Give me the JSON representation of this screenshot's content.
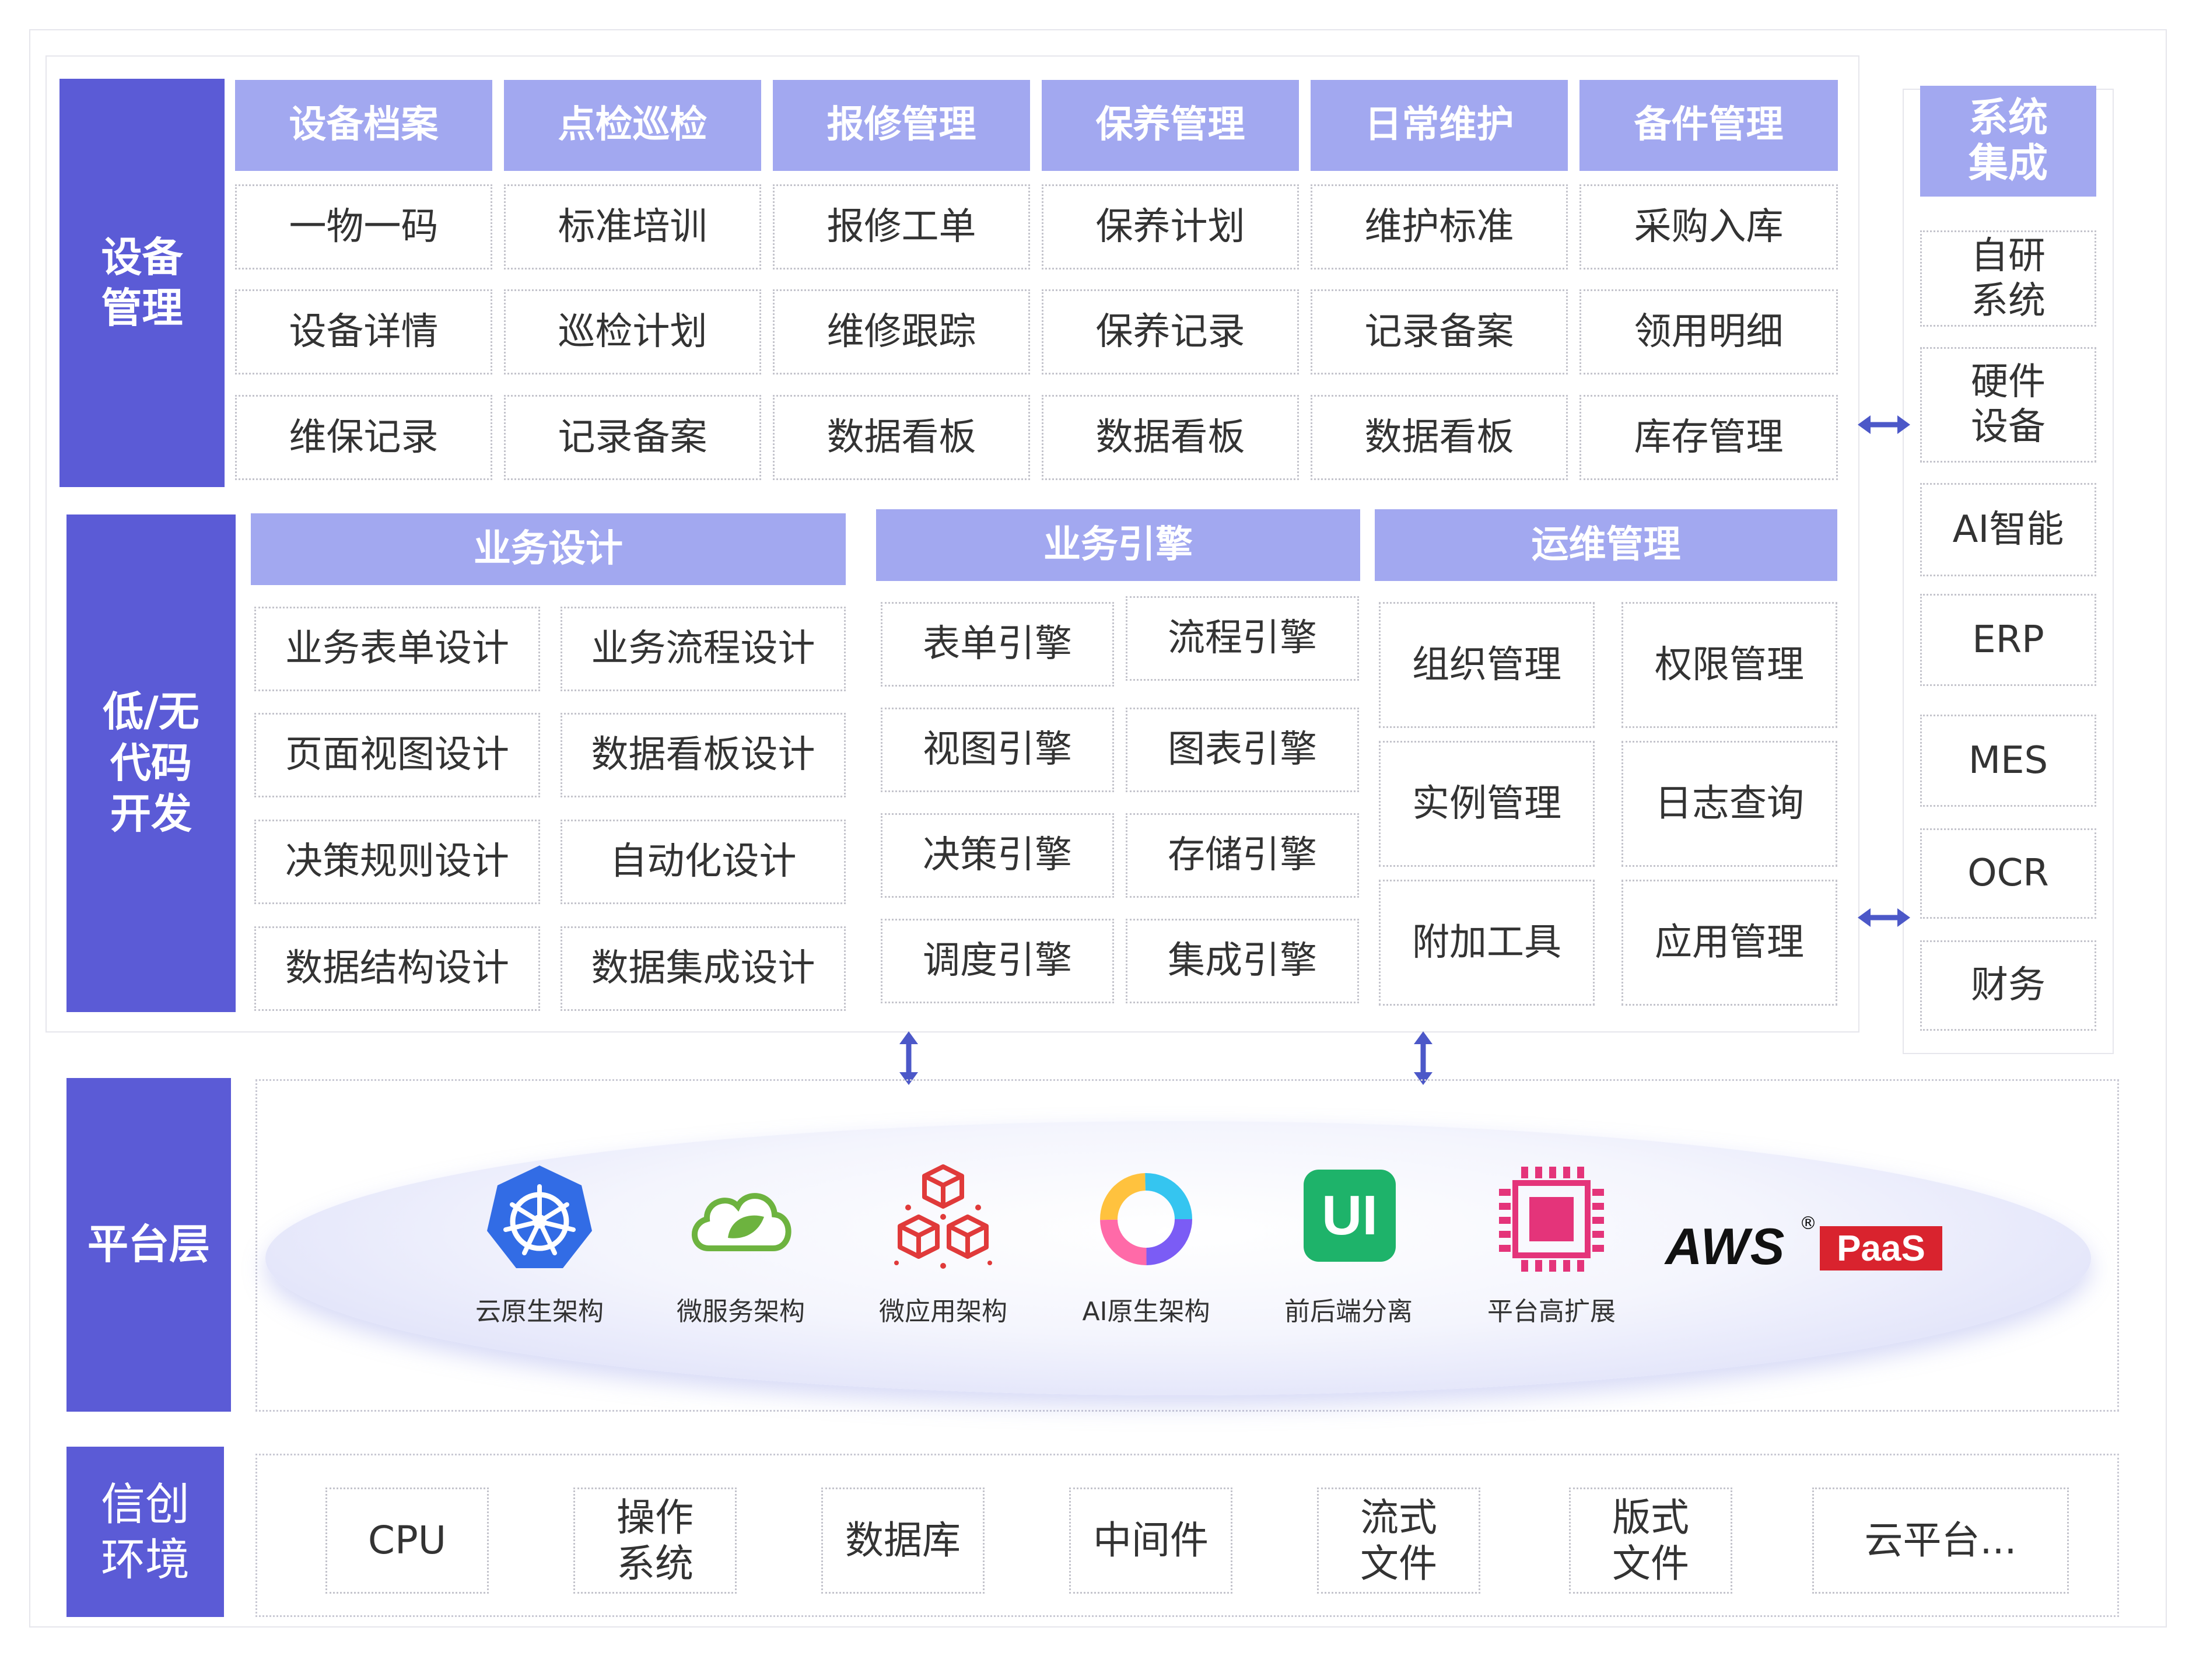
{
  "colors": {
    "side_bg": "#5b5bd6",
    "header_bg": "#a2a8f0",
    "arrow": "#4c58c8",
    "aws_red": "#d9232e"
  },
  "device_mgmt": {
    "label": "设备\n管理",
    "columns": [
      {
        "header": "设备档案",
        "items": [
          "一物一码",
          "设备详情",
          "维保记录"
        ]
      },
      {
        "header": "点检巡检",
        "items": [
          "标准培训",
          "巡检计划",
          "记录备案"
        ]
      },
      {
        "header": "报修管理",
        "items": [
          "报修工单",
          "维修跟踪",
          "数据看板"
        ]
      },
      {
        "header": "保养管理",
        "items": [
          "保养计划",
          "保养记录",
          "数据看板"
        ]
      },
      {
        "header": "日常维护",
        "items": [
          "维护标准",
          "记录备案",
          "数据看板"
        ]
      },
      {
        "header": "备件管理",
        "items": [
          "采购入库",
          "领用明细",
          "库存管理"
        ]
      }
    ]
  },
  "lowcode": {
    "label": "低/无\n代码\n开发",
    "groups": [
      {
        "header": "业务设计",
        "items": [
          "业务表单设计",
          "业务流程设计",
          "页面视图设计",
          "数据看板设计",
          "决策规则设计",
          "自动化设计",
          "数据结构设计",
          "数据集成设计"
        ]
      },
      {
        "header": "业务引擎",
        "items": [
          "表单引擎",
          "流程引擎",
          "视图引擎",
          "图表引擎",
          "决策引擎",
          "存储引擎",
          "调度引擎",
          "集成引擎"
        ]
      },
      {
        "header": "运维管理",
        "items": [
          "组织管理",
          "权限管理",
          "实例管理",
          "日志查询",
          "附加工具",
          "应用管理"
        ]
      }
    ]
  },
  "system_integration": {
    "header": "系统\n集成",
    "items": [
      "自研\n系统",
      "硬件\n设备",
      "AI智能",
      "ERP",
      "MES",
      "OCR",
      "财务"
    ]
  },
  "platform": {
    "label": "平台层",
    "items": [
      {
        "icon": "kubernetes-icon",
        "label": "云原生架构"
      },
      {
        "icon": "spring-cloud-icon",
        "label": "微服务架构"
      },
      {
        "icon": "cubes-icon",
        "label": "微应用架构"
      },
      {
        "icon": "ai-ring-icon",
        "label": "AI原生架构"
      },
      {
        "icon": "ui-icon",
        "label": "前后端分离"
      },
      {
        "icon": "chip-icon",
        "label": "平台高扩展"
      }
    ],
    "ui_icon_text": "UI",
    "aws_text": "AWS",
    "aws_reg": "®",
    "paas_text": "PaaS"
  },
  "xinchuang": {
    "label": "信创\n环境",
    "items": [
      "CPU",
      "操作\n系统",
      "数据库",
      "中间件",
      "流式\n文件",
      "版式\n文件",
      "云平台..."
    ]
  }
}
